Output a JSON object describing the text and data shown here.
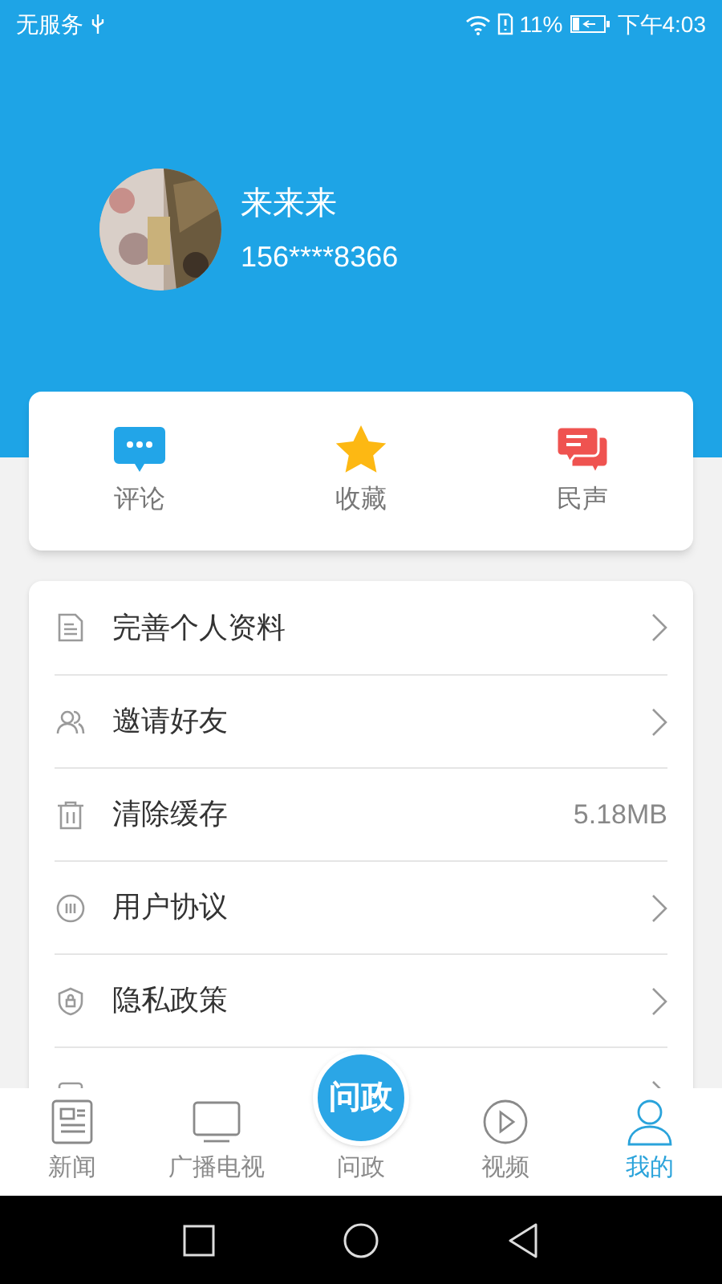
{
  "status_bar": {
    "carrier": "无服务",
    "battery": "11%",
    "time": "下午4:03"
  },
  "profile": {
    "name": "来来来",
    "phone": "156****8366"
  },
  "shortcuts": [
    {
      "kind": "comment",
      "label": "评论"
    },
    {
      "kind": "star",
      "label": "收藏"
    },
    {
      "kind": "voice",
      "label": "民声"
    }
  ],
  "menu": [
    {
      "kind": "doc",
      "label": "完善个人资料",
      "chevron": true
    },
    {
      "kind": "friends",
      "label": "邀请好友",
      "chevron": true
    },
    {
      "kind": "trash",
      "label": "清除缓存",
      "value": "5.18MB",
      "chevron": false
    },
    {
      "kind": "agreement",
      "label": "用户协议",
      "chevron": true
    },
    {
      "kind": "shield",
      "label": "隐私政策",
      "chevron": true
    },
    {
      "kind": "feedback",
      "chevron": true
    }
  ],
  "tabs": [
    {
      "kind": "news",
      "label": "新闻",
      "selected": false
    },
    {
      "kind": "tv",
      "label": "广播电视",
      "selected": false
    },
    {
      "kind": "center",
      "label": "问政",
      "logo_text": "问政",
      "selected": false
    },
    {
      "kind": "video",
      "label": "视频",
      "selected": false
    },
    {
      "kind": "user",
      "label": "我的",
      "selected": true
    }
  ]
}
